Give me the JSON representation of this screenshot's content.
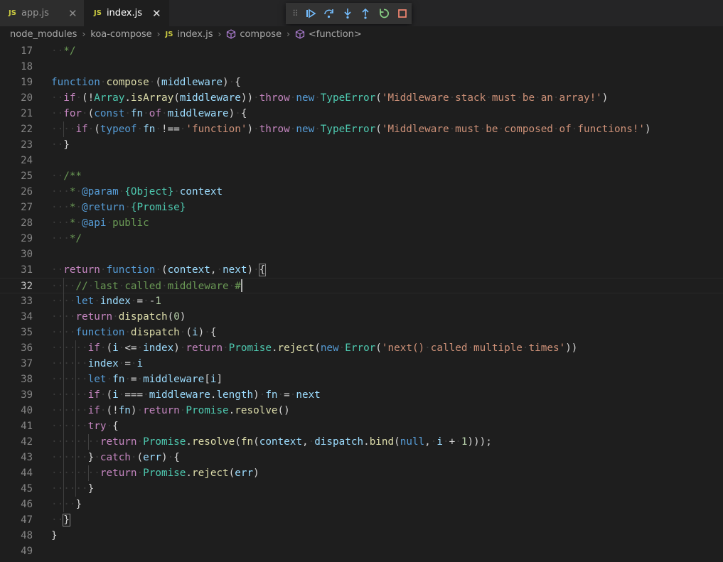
{
  "tabs": [
    {
      "label": "app.js",
      "icon": "JS",
      "active": false
    },
    {
      "label": "index.js",
      "icon": "JS",
      "active": true
    }
  ],
  "tab_close_glyph": "✕",
  "debug_toolbar": {
    "grip": "⠿",
    "buttons": [
      "continue-icon",
      "step-over-icon",
      "step-into-icon",
      "step-out-icon",
      "restart-icon",
      "stop-icon"
    ]
  },
  "breadcrumb": {
    "items": [
      "node_modules",
      "koa-compose",
      "index.js",
      "compose",
      "<function>"
    ],
    "separator": "›"
  },
  "editor": {
    "language": "javascript",
    "current_line": 32,
    "lines": [
      {
        "n": 17,
        "text": "  */"
      },
      {
        "n": 18,
        "text": ""
      },
      {
        "n": 19,
        "text": "function compose (middleware) {"
      },
      {
        "n": 20,
        "text": "  if (!Array.isArray(middleware)) throw new TypeError('Middleware stack must be an array!')"
      },
      {
        "n": 21,
        "text": "  for (const fn of middleware) {"
      },
      {
        "n": 22,
        "text": "    if (typeof fn !== 'function') throw new TypeError('Middleware must be composed of functions!')"
      },
      {
        "n": 23,
        "text": "  }"
      },
      {
        "n": 24,
        "text": ""
      },
      {
        "n": 25,
        "text": "  /**"
      },
      {
        "n": 26,
        "text": "   * @param {Object} context"
      },
      {
        "n": 27,
        "text": "   * @return {Promise}"
      },
      {
        "n": 28,
        "text": "   * @api public"
      },
      {
        "n": 29,
        "text": "   */"
      },
      {
        "n": 30,
        "text": ""
      },
      {
        "n": 31,
        "text": "  return function (context, next) {"
      },
      {
        "n": 32,
        "text": "    // last called middleware #"
      },
      {
        "n": 33,
        "text": "    let index = -1"
      },
      {
        "n": 34,
        "text": "    return dispatch(0)"
      },
      {
        "n": 35,
        "text": "    function dispatch (i) {"
      },
      {
        "n": 36,
        "text": "      if (i <= index) return Promise.reject(new Error('next() called multiple times'))"
      },
      {
        "n": 37,
        "text": "      index = i"
      },
      {
        "n": 38,
        "text": "      let fn = middleware[i]"
      },
      {
        "n": 39,
        "text": "      if (i === middleware.length) fn = next"
      },
      {
        "n": 40,
        "text": "      if (!fn) return Promise.resolve()"
      },
      {
        "n": 41,
        "text": "      try {"
      },
      {
        "n": 42,
        "text": "        return Promise.resolve(fn(context, dispatch.bind(null, i + 1)));"
      },
      {
        "n": 43,
        "text": "      } catch (err) {"
      },
      {
        "n": 44,
        "text": "        return Promise.reject(err)"
      },
      {
        "n": 45,
        "text": "      }"
      },
      {
        "n": 46,
        "text": "    }"
      },
      {
        "n": 47,
        "text": "  }"
      },
      {
        "n": 48,
        "text": "}"
      },
      {
        "n": 49,
        "text": ""
      }
    ]
  },
  "colors": {
    "editor_bg": "#1e1e1e",
    "tabbar_bg": "#252526",
    "keyword": "#569cd6",
    "control": "#c586c0",
    "function": "#dcdcaa",
    "class": "#4ec9b0",
    "variable": "#9cdcfe",
    "string": "#ce9178",
    "number": "#b5cea8",
    "comment": "#6a9955",
    "js_badge": "#cbcb41"
  }
}
